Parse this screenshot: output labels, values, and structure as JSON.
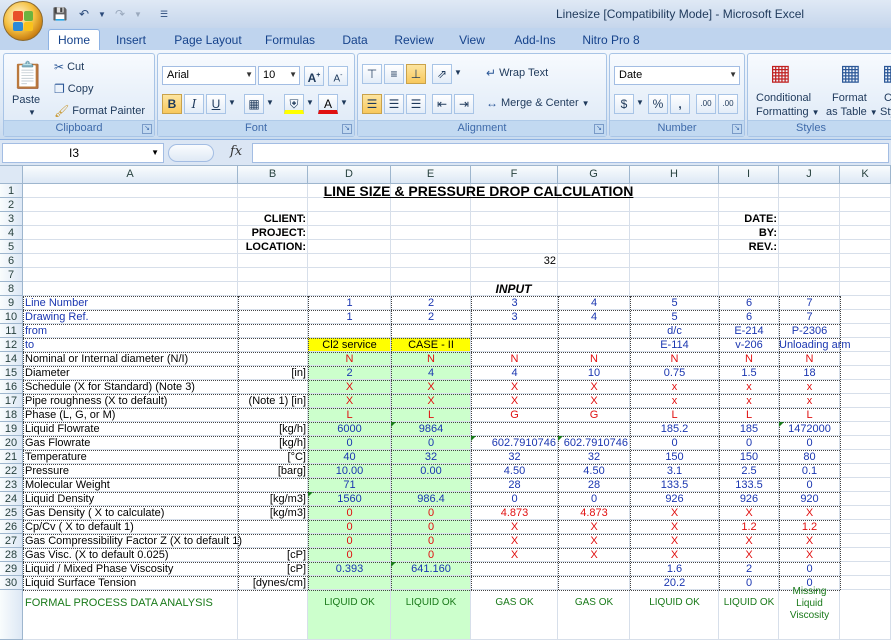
{
  "window": {
    "title": "Linesize  [Compatibility Mode]  -  Microsoft Excel"
  },
  "tabs": [
    "Home",
    "Insert",
    "Page Layout",
    "Formulas",
    "Data",
    "Review",
    "View",
    "Add-Ins",
    "Nitro Pro 8"
  ],
  "ribbon": {
    "clipboard": {
      "label": "Clipboard",
      "paste": "Paste",
      "cut": "Cut",
      "copy": "Copy",
      "format_painter": "Format Painter"
    },
    "font": {
      "label": "Font",
      "font_name": "Arial",
      "font_size": "10",
      "bold": "B",
      "italic": "I",
      "underline": "U"
    },
    "alignment": {
      "label": "Alignment",
      "wrap_text": "Wrap Text",
      "merge_center": "Merge & Center"
    },
    "number": {
      "label": "Number",
      "format": "Date",
      "currency": "$",
      "percent": "%",
      "comma": ",",
      "inc_dec": ".00",
      "dec_dec": ".00"
    },
    "styles": {
      "label": "Styles",
      "conditional": "Conditional",
      "conditional2": "Formatting",
      "format_as": "Format",
      "format_as2": "as Table",
      "cell_styles": "C",
      "cell_styles2": "Sty"
    }
  },
  "formula_bar": {
    "name_box": "I3",
    "fx": "fx",
    "content": ""
  },
  "columns": [
    "A",
    "B",
    "D",
    "E",
    "F",
    "G",
    "H",
    "I",
    "J",
    "K"
  ],
  "rows": [
    "1",
    "2",
    "3",
    "4",
    "5",
    "6",
    "7",
    "8",
    "9",
    "10",
    "11",
    "12",
    "14",
    "15",
    "16",
    "17",
    "18",
    "19",
    "20",
    "21",
    "22",
    "23",
    "24",
    "25",
    "26",
    "27",
    "28",
    "29",
    "30",
    ""
  ],
  "sheet": {
    "title": "LINE SIZE & PRESSURE DROP CALCULATION",
    "client": "CLIENT:",
    "project": "PROJECT:",
    "location": "LOCATION:",
    "date": "DATE:",
    "by": "BY:",
    "rev": "REV.:",
    "f6": "32",
    "input": "INPUT",
    "labels": {
      "r9": "Line Number",
      "r10": "Drawing Ref.",
      "r11": "from",
      "r12": "to",
      "r14": "Nominal or Internal diameter (N/I)",
      "r15": "Diameter",
      "r16": "Schedule (X for Standard) (Note 3)",
      "r17": "Pipe roughness (X to default)",
      "r18": "Phase (L, G, or M)",
      "r19": "Liquid Flowrate",
      "r20": "Gas Flowrate",
      "r21": "Temperature",
      "r22": "Pressure",
      "r23": "Molecular Weight",
      "r24": "Liquid Density",
      "r25": "Gas Density ( X to calculate)",
      "r26": "Cp/Cv  ( X to default 1)",
      "r27": "Gas Compressibility Factor Z (X to default 1)",
      "r28": "Gas Visc. (X to default 0.025)",
      "r29": "Liquid / Mixed Phase Viscosity",
      "r30": "Liquid Surface Tension",
      "r31": "FORMAL PROCESS DATA ANALYSIS"
    },
    "units": {
      "r15": "[in]",
      "r17": "(Note 1) [in]",
      "r19": "[kg/h]",
      "r20": "[kg/h]",
      "r21": "[°C]",
      "r22": "[barg]",
      "r24": "[kg/m3]",
      "r25": "[kg/m3]",
      "r28": "[cP]",
      "r29": "[cP]",
      "r30": "[dynes/cm]"
    },
    "data": {
      "r9": [
        "1",
        "2",
        "3",
        "4",
        "5",
        "6",
        "7"
      ],
      "r10": [
        "1",
        "2",
        "3",
        "4",
        "5",
        "6",
        "7"
      ],
      "r11": [
        "",
        "",
        "",
        "",
        "d/c",
        "E-214",
        "P-2306"
      ],
      "r12": [
        "Cl2 service",
        "CASE - II",
        "",
        "",
        "E-114",
        "v-206",
        "Unloading arm"
      ],
      "r14": [
        "N",
        "N",
        "N",
        "N",
        "N",
        "N",
        "N"
      ],
      "r15": [
        "2",
        "4",
        "4",
        "10",
        "0.75",
        "1.5",
        "18"
      ],
      "r16": [
        "X",
        "X",
        "X",
        "X",
        "x",
        "x",
        "x"
      ],
      "r17": [
        "X",
        "X",
        "X",
        "X",
        "x",
        "x",
        "x"
      ],
      "r18": [
        "L",
        "L",
        "G",
        "G",
        "L",
        "L",
        "L"
      ],
      "r19": [
        "6000",
        "9864",
        "",
        "",
        "185.2",
        "185",
        "1472000"
      ],
      "r20": [
        "0",
        "0",
        "602.7910746",
        "602.7910746",
        "0",
        "0",
        "0"
      ],
      "r21": [
        "40",
        "32",
        "32",
        "32",
        "150",
        "150",
        "80"
      ],
      "r22": [
        "10.00",
        "0.00",
        "4.50",
        "4.50",
        "3.1",
        "2.5",
        "0.1"
      ],
      "r23": [
        "71",
        "",
        "28",
        "28",
        "133.5",
        "133.5",
        "0"
      ],
      "r24": [
        "1560",
        "986.4",
        "0",
        "0",
        "926",
        "926",
        "920"
      ],
      "r25": [
        "0",
        "0",
        "4.873",
        "4.873",
        "X",
        "X",
        "X"
      ],
      "r26": [
        "0",
        "0",
        "X",
        "X",
        "X",
        "1.2",
        "1.2"
      ],
      "r27": [
        "0",
        "0",
        "X",
        "X",
        "X",
        "X",
        "X"
      ],
      "r28": [
        "0",
        "0",
        "X",
        "X",
        "X",
        "X",
        "X"
      ],
      "r29": [
        "0.393",
        "641.160",
        "",
        "",
        "1.6",
        "2",
        "0"
      ],
      "r30": [
        "",
        "",
        "",
        "",
        "20.2",
        "0",
        "0"
      ],
      "r31": [
        "LIQUID OK",
        "LIQUID OK",
        "GAS OK",
        "GAS OK",
        "LIQUID OK",
        "LIQUID OK",
        "Missing Liquid Viscosity"
      ]
    },
    "colors": {
      "input_green": "#ccffcc",
      "highlight_yellow": "#ffff00",
      "value_blue": "#1a36b0",
      "flag_red": "#e01010",
      "ok_green": "#1a7a1a"
    }
  }
}
